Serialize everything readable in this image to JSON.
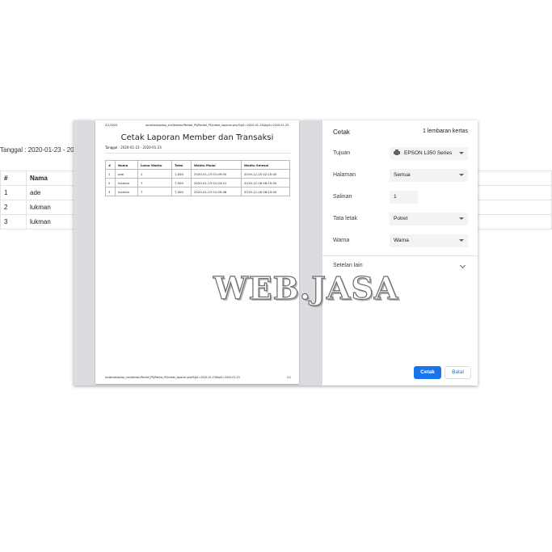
{
  "background": {
    "date_line": "Tanggal : 2020-01-23 - 2020-0",
    "columns": [
      "#",
      "Nama"
    ],
    "rows": [
      {
        "no": "1",
        "name": "ade"
      },
      {
        "no": "2",
        "name": "lukman"
      },
      {
        "no": "3",
        "name": "lukman"
      }
    ]
  },
  "preview": {
    "header_date": "2/1/2020",
    "header_url": "localhost/aplop_xml/kemen/Rental_PS/Rental_PS/cetak_laporan.php?tgl1=2020-01-23&tgl2=2020-01-23",
    "title": "Cetak Laporan Member dan Transaksi",
    "date_line": "Tanggal : 2020-01-23 - 2020-01-23",
    "columns": [
      "#",
      "Nama",
      "Lama Waktu",
      "Total",
      "Waktu Mulai",
      "Waktu Selesai"
    ],
    "rows": [
      [
        "1",
        "ade",
        "1",
        "1,000",
        "2020-01-23 01:09:55",
        "2019-12-15 02:15:00"
      ],
      [
        "2",
        "lukman",
        "7",
        "7,000",
        "2020-01-23 01:04:21",
        "2019-12-16 08:15:00"
      ],
      [
        "3",
        "lukman",
        "7",
        "7,000",
        "2020-01-23 01:59:48",
        "2019-12-16 08:15:00"
      ]
    ],
    "footer_url": "localhost/aplop_xml/kemen/Rental_PS/Rental_PS/cetak_laporan.php?tgl1=2020-01-23&tgl2=2020-01-23",
    "footer_page": "1/1"
  },
  "settings": {
    "title": "Cetak",
    "sheet_count": "1 lembaran kertas",
    "destination_label": "Tujuan",
    "destination_value": "EPSON L350 Series",
    "pages_label": "Halaman",
    "pages_value": "Semua",
    "copies_label": "Salinan",
    "copies_value": "1",
    "layout_label": "Tata letak",
    "layout_value": "Potret",
    "color_label": "Warna",
    "color_value": "Warna",
    "more_settings": "Setelan lain",
    "print_button": "Cetak",
    "cancel_button": "Batal"
  },
  "watermark": "WEB.JASA",
  "colors": {
    "accent": "#1a73e8",
    "preview_bg": "#dadce0",
    "select_bg": "#f1f3f4"
  }
}
